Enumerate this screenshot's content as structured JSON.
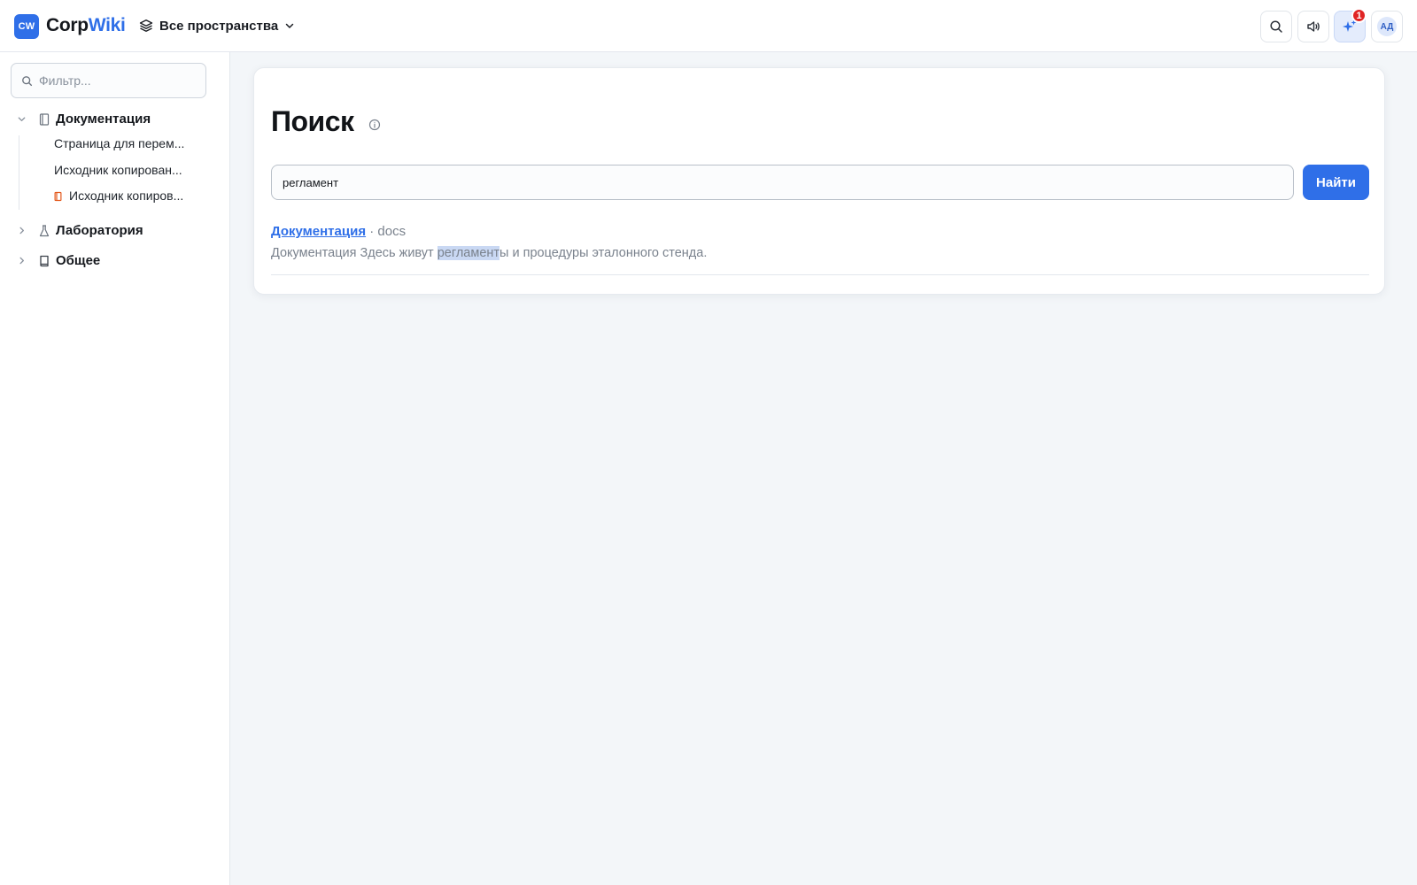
{
  "app": {
    "logo_mark": "CW",
    "name_part1": "Corp",
    "name_part2": "Wiki",
    "space_switch_label": "Все пространства"
  },
  "header": {
    "notifications_count": "1",
    "avatar_initials": "АД"
  },
  "sidebar": {
    "filter_placeholder": "Фильтр...",
    "spaces": [
      {
        "label": "Документация",
        "expanded": true,
        "children": [
          {
            "label": "Страница для перем..."
          },
          {
            "label": "Исходник копирован..."
          },
          {
            "label": "Исходник копиров..."
          }
        ]
      },
      {
        "label": "Лаборатория",
        "expanded": false
      },
      {
        "label": "Общее",
        "expanded": false
      }
    ]
  },
  "main": {
    "title": "Поиск",
    "query": "регламент",
    "find_button": "Найти",
    "results": [
      {
        "title": "Документация",
        "separator": "·",
        "space_key": "docs",
        "snippet_before": "Документация Здесь живут ",
        "snippet_match": "регламент",
        "snippet_after": "ы и процедуры эталонного стенда."
      }
    ]
  },
  "colors": {
    "accent": "#2f6fe8",
    "badge": "#e02424",
    "page_background": "#f3f6f9",
    "highlight": "#c9d8f3"
  }
}
